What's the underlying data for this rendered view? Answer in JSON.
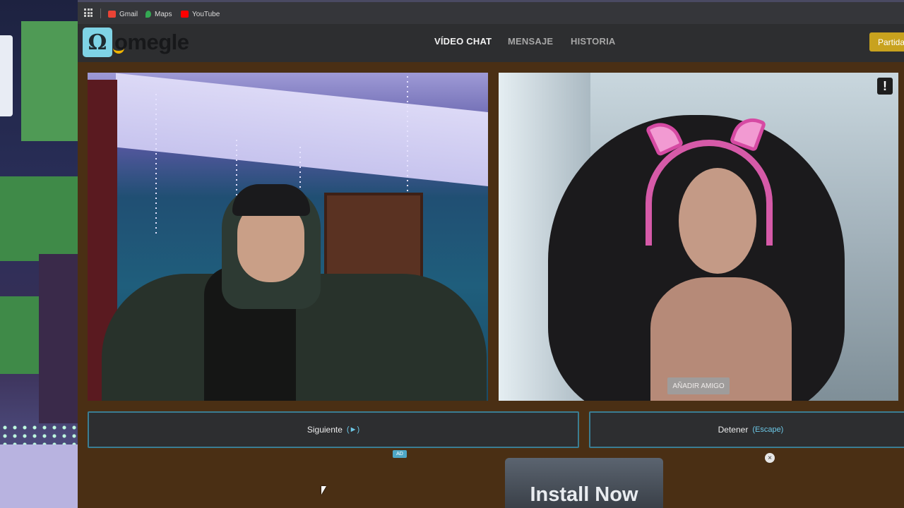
{
  "bookmarks": [
    {
      "label": "Gmail",
      "icon": "gmail-icon",
      "color": "#ea4335"
    },
    {
      "label": "Maps",
      "icon": "maps-icon",
      "color": "#34a853"
    },
    {
      "label": "YouTube",
      "icon": "youtube-icon",
      "color": "#ff0000"
    }
  ],
  "header": {
    "logo_text": "omegle",
    "logo_glyph": "Ω",
    "nav": [
      "VÍDEO CHAT",
      "MENSAJE",
      "HISTORIA"
    ],
    "right_button": "Partida"
  },
  "video_right": {
    "report_label": "!",
    "add_friend_label": "AÑADIR AMIGO"
  },
  "controls": {
    "next_label": "Siguiente",
    "next_key": "(►)",
    "stop_label": "Detener",
    "stop_key": "(Escape)"
  },
  "ad": {
    "tag": "AD",
    "close": "×",
    "install_label": "Install Now"
  },
  "colors": {
    "accent": "#6cc7e6",
    "brand": "#7fd3e6",
    "page_bg": "#4a2f14",
    "partida": "#c8a21e"
  }
}
